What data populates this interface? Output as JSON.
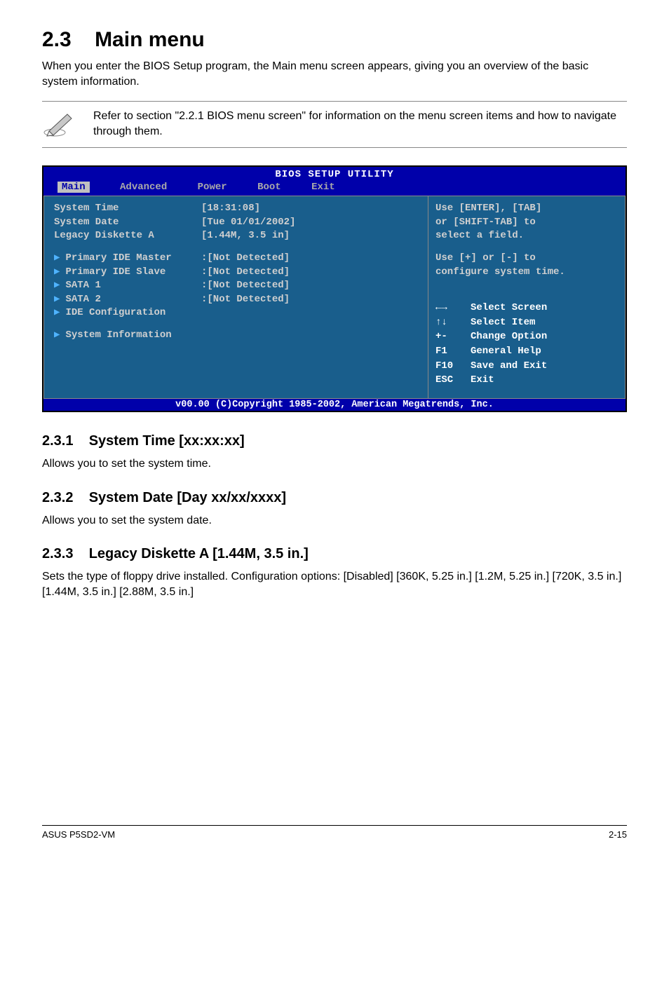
{
  "heading": {
    "num": "2.3",
    "title": "Main menu"
  },
  "intro": "When you enter the BIOS Setup program, the Main menu screen appears, giving you an overview of the basic system information.",
  "note": "Refer to section \"2.2.1  BIOS menu screen\" for information on the menu screen items and how to navigate through them.",
  "bios": {
    "title": "BIOS SETUP UTILITY",
    "tabs": {
      "main": "Main",
      "advanced": "Advanced",
      "power": "Power",
      "boot": "Boot",
      "exit": "Exit"
    },
    "items": {
      "sys_time_l": "System Time",
      "sys_time_v": "[18:31:08]",
      "sys_date_l": "System Date",
      "sys_date_v": "[Tue 01/01/2002]",
      "legacy_l": "Legacy Diskette A",
      "legacy_v": "[1.44M, 3.5 in]",
      "pide_m_l": "Primary IDE Master",
      "pide_m_v": ":[Not Detected]",
      "pide_s_l": "Primary IDE Slave",
      "pide_s_v": ":[Not Detected]",
      "sata1_l": "SATA 1",
      "sata1_v": ":[Not Detected]",
      "sata2_l": "SATA 2",
      "sata2_v": ":[Not Detected]",
      "idecfg_l": "IDE Configuration",
      "sysinfo_l": "System Information"
    },
    "help": {
      "l1": "Use [ENTER], [TAB]",
      "l2": "or [SHIFT-TAB] to",
      "l3": "select a field.",
      "l4": "Use [+] or [-] to",
      "l5": "configure system time."
    },
    "nav": {
      "k1": "←→",
      "t1": "Select Screen",
      "k2": "↑↓",
      "t2": "Select Item",
      "k3": "+-",
      "t3": "Change Option",
      "k4": "F1",
      "t4": "General Help",
      "k5": "F10",
      "t5": "Save and Exit",
      "k6": "ESC",
      "t6": "Exit"
    },
    "footer": "v00.00 (C)Copyright 1985-2002, American Megatrends, Inc."
  },
  "sections": {
    "s1_num": "2.3.1",
    "s1_title": "System Time [xx:xx:xx]",
    "s1_body": "Allows you to set the system time.",
    "s2_num": "2.3.2",
    "s2_title": "System Date [Day xx/xx/xxxx]",
    "s2_body": "Allows you to set the system date.",
    "s3_num": "2.3.3",
    "s3_title": "Legacy Diskette A [1.44M, 3.5 in.]",
    "s3_body": "Sets the type of floppy drive installed. Configuration options: [Disabled] [360K, 5.25 in.] [1.2M, 5.25 in.] [720K, 3.5 in.] [1.44M, 3.5 in.] [2.88M, 3.5 in.]"
  },
  "footer": {
    "left": "ASUS P5SD2-VM",
    "right": "2-15"
  }
}
